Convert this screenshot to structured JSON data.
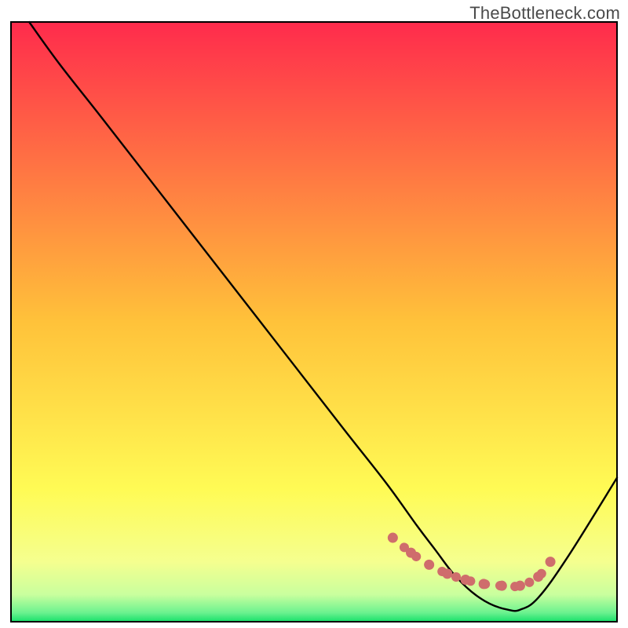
{
  "watermark": "TheBottleneck.com",
  "colors": {
    "frame": "#000000",
    "curve": "#000000",
    "marker_series": "#cf6d6c",
    "gradient_stops": [
      {
        "offset": 0.0,
        "color": "#ff2b4c"
      },
      {
        "offset": 0.5,
        "color": "#ffc23a"
      },
      {
        "offset": 0.78,
        "color": "#fffb55"
      },
      {
        "offset": 0.9,
        "color": "#f5ff8f"
      },
      {
        "offset": 0.955,
        "color": "#c9ff9e"
      },
      {
        "offset": 0.985,
        "color": "#6bf28f"
      },
      {
        "offset": 1.0,
        "color": "#16e06a"
      }
    ]
  },
  "chart_data": {
    "type": "line",
    "title": "",
    "xlabel": "",
    "ylabel": "",
    "xlim": [
      0,
      100
    ],
    "ylim": [
      0,
      100
    ],
    "series": [
      {
        "name": "bottleneck-curve",
        "x": [
          3,
          8,
          15,
          25,
          35,
          45,
          55,
          62,
          67,
          70,
          73,
          76,
          79,
          82,
          84,
          87,
          92,
          100
        ],
        "y": [
          100,
          93,
          84,
          71,
          58,
          45,
          32,
          23,
          16,
          12,
          8,
          5,
          3,
          2,
          2,
          4,
          11,
          24
        ]
      }
    ],
    "markers": {
      "name": "bottleneck-flat-points",
      "x": [
        63,
        66,
        69,
        72,
        75,
        78,
        81,
        84,
        87,
        89
      ],
      "y": [
        14,
        11.5,
        9.5,
        8,
        7,
        6.3,
        6,
        6,
        7.5,
        10
      ]
    }
  }
}
